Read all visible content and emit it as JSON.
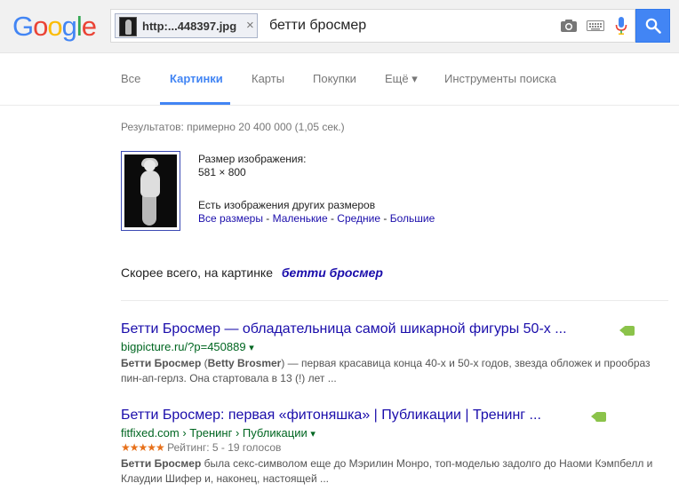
{
  "logo": {
    "letters": [
      "G",
      "o",
      "o",
      "g",
      "l",
      "e"
    ],
    "colors": [
      "#4285f4",
      "#ea4335",
      "#fbbc05",
      "#4285f4",
      "#34a853",
      "#ea4335"
    ]
  },
  "search": {
    "chip_text": "http:...448397.jpg",
    "close": "×",
    "query": "бетти бросмер"
  },
  "tabs": [
    "Все",
    "Картинки",
    "Карты",
    "Покупки",
    "Ещё ▾",
    "Инструменты поиска"
  ],
  "stats": "Результатов: примерно 20 400 000 (1,05 сек.)",
  "image_info": {
    "size_label": "Размер изображения:",
    "size_value": "581 × 800",
    "other_sizes_label": "Есть изображения других размеров",
    "sizes": [
      "Все размеры",
      "Маленькие",
      "Средние",
      "Большие"
    ],
    "separator": " - "
  },
  "guess": {
    "prefix": "Скорее всего, на картинке",
    "term": "бетти бросмер"
  },
  "results": [
    {
      "title": "Бетти Бросмер — обладательница самой шикарной фигуры 50-х ...",
      "url": "bigpicture.ru/?p=450889",
      "snippet_bold": "Бетти Бросмер",
      "snippet_1": " (",
      "snippet_bold2": "Betty Brosmer",
      "snippet_2": ") — первая красавица конца 40-х и 50-х годов, звезда обложек и прообраз пин-ап-герлз. Она стартовала в 13 (!) лет ..."
    },
    {
      "title": "Бетти Бросмер: первая «фитоняшка» | Публикации | Тренинг ...",
      "url": "fitfixed.com › Тренинг › Публикации",
      "stars": "★★★★★",
      "rating": "Рейтинг: 5 - 19 голосов",
      "snippet_bold": "Бетти Бросмер",
      "snippet_2": " была секс-символом еще до Мэрилин Монро, топ-моделью задолго до Наоми Кэмпбелл и Клаудии Шифер и, наконец, настоящей ..."
    }
  ],
  "dropdown_arrow": "▾"
}
